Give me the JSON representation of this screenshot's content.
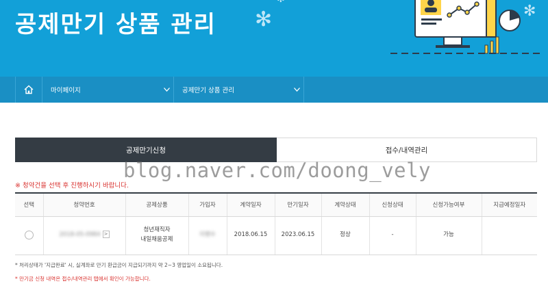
{
  "header": {
    "title": "공제만기 상품 관리"
  },
  "nav": {
    "items": [
      {
        "label": "마이페이지"
      },
      {
        "label": "공제만기 상품 관리"
      }
    ]
  },
  "tabs": [
    {
      "label": "공제만기신청",
      "active": true
    },
    {
      "label": "접수/내역관리",
      "active": false
    }
  ],
  "watermark": "blog.naver.com/doong_vely",
  "notice": "※ 청약건을 선택 후 진행하시기 바랍니다.",
  "table": {
    "columns": [
      "선택",
      "청약번호",
      "공제상품",
      "가입자",
      "계약일자",
      "만기일자",
      "계약상태",
      "신청상태",
      "신청가능여부",
      "지급예정일자"
    ],
    "rows": [
      {
        "subscription_no": "2018-05-0984",
        "product_line1": "청년재직자",
        "product_line2": "내일채움공제",
        "subscriber": "이병수",
        "contract_date": "2018.06.15",
        "maturity_date": "2023.06.15",
        "contract_status": "정상",
        "application_status": "-",
        "eligibility": "가능",
        "payment_date": ""
      }
    ],
    "detail_button": ">"
  },
  "footnotes": {
    "note1": "* 처리상태가 '지급완료' 시, 실계좌로 만기 환급금이 지급되기까지 약 2~3 영업일이 소요됩니다.",
    "note2": "* 만기금 신청 내역은 접수/내역관리 탭에서 확인이 가능합니다."
  },
  "colors": {
    "banner": "#12a0d8",
    "navbar": "#1a8fc4",
    "active_tab": "#343c44",
    "notice_red": "#d9322f"
  },
  "icons": {
    "home": "home-icon",
    "chevron": "chevron-down-icon"
  }
}
